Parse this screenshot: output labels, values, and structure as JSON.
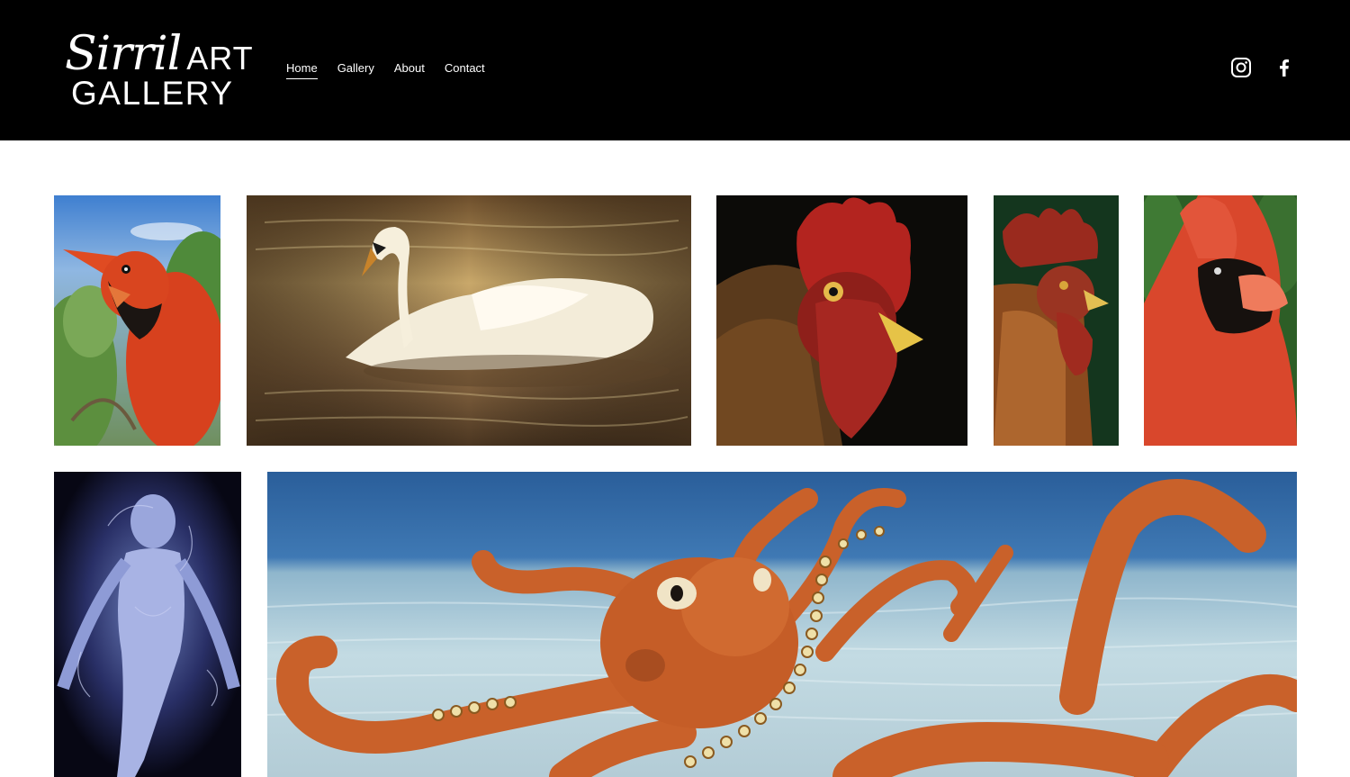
{
  "site": {
    "logo_script": "Sirril",
    "logo_word1": "ART",
    "logo_word2": "GALLERY"
  },
  "nav": {
    "items": [
      {
        "label": "Home",
        "active": true
      },
      {
        "label": "Gallery",
        "active": false
      },
      {
        "label": "About",
        "active": false
      },
      {
        "label": "Contact",
        "active": false
      }
    ]
  },
  "social": {
    "icons": [
      "instagram-icon",
      "facebook-icon"
    ]
  },
  "colors": {
    "header_bg": "#000000",
    "header_text": "#ffffff",
    "page_bg": "#ffffff"
  },
  "gallery": {
    "row1": [
      "cardinal-painting",
      "swan-painting",
      "rooster-painting",
      "rooster-profile-painting",
      "cardinal-closeup-painting"
    ],
    "row2": [
      "figure-painting",
      "octopus-painting"
    ]
  }
}
